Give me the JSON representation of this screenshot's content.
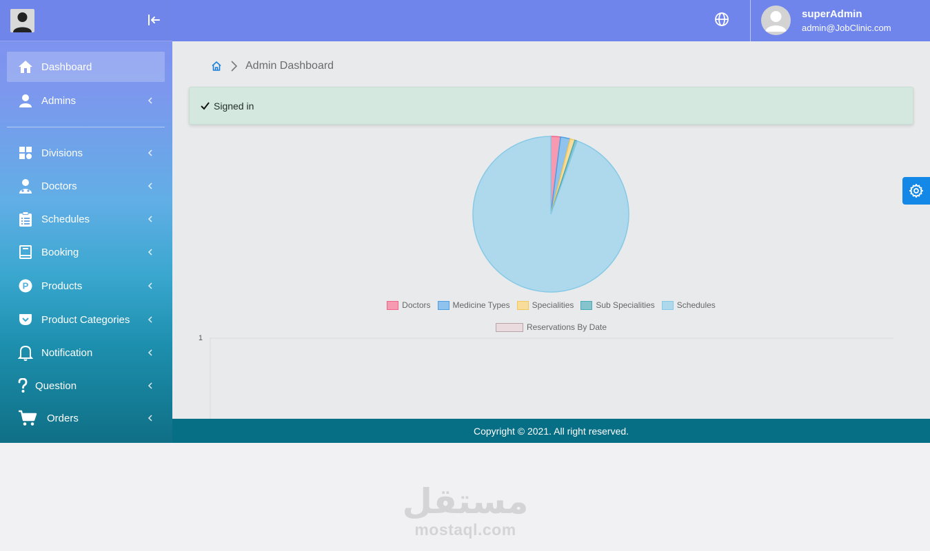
{
  "sidebar": {
    "items": [
      {
        "label": "Dashboard",
        "icon": "home-icon"
      },
      {
        "label": "Admins",
        "icon": "user-icon"
      },
      {
        "label": "Divisions",
        "icon": "grid-icon"
      },
      {
        "label": "Doctors",
        "icon": "doctor-icon"
      },
      {
        "label": "Schedules",
        "icon": "clipboard-icon"
      },
      {
        "label": "Booking",
        "icon": "book-icon"
      },
      {
        "label": "Products",
        "icon": "product-p-icon"
      },
      {
        "label": "Product Categories",
        "icon": "pocket-icon"
      },
      {
        "label": "Notification",
        "icon": "bell-icon"
      },
      {
        "label": "Question",
        "icon": "question-icon"
      },
      {
        "label": "Orders",
        "icon": "cart-icon"
      }
    ]
  },
  "header": {
    "user_name": "superAdmin",
    "user_email": "admin@JobClinic.com"
  },
  "main": {
    "breadcrumb_title": "Admin Dashboard",
    "alert_text": "Signed in"
  },
  "chart_data": [
    {
      "type": "pie",
      "categories": [
        "Doctors",
        "Medicine Types",
        "Specialities",
        "Sub Specialities",
        "Schedules"
      ],
      "values": [
        2,
        2,
        1,
        0.5,
        94.5
      ],
      "colors": [
        "#f59ab1",
        "#8fc2ec",
        "#f7dc9a",
        "#86c4cd",
        "#aed8eb"
      ],
      "borders": [
        "#f26487",
        "#4d9ee2",
        "#f3c85a",
        "#4aa9b7",
        "#86c9e6"
      ],
      "legend_position": "bottom"
    },
    {
      "type": "line",
      "series": [
        {
          "name": "Reservations By Date",
          "values": []
        }
      ],
      "y_ticks": [
        "1"
      ],
      "colors": [
        "#e6c6cc"
      ],
      "legend_position": "top"
    }
  ],
  "footer": {
    "copyright": "Copyright © 2021. All right reserved."
  },
  "watermark": {
    "arabic": "مستقل",
    "latin": "mostaql.com"
  }
}
